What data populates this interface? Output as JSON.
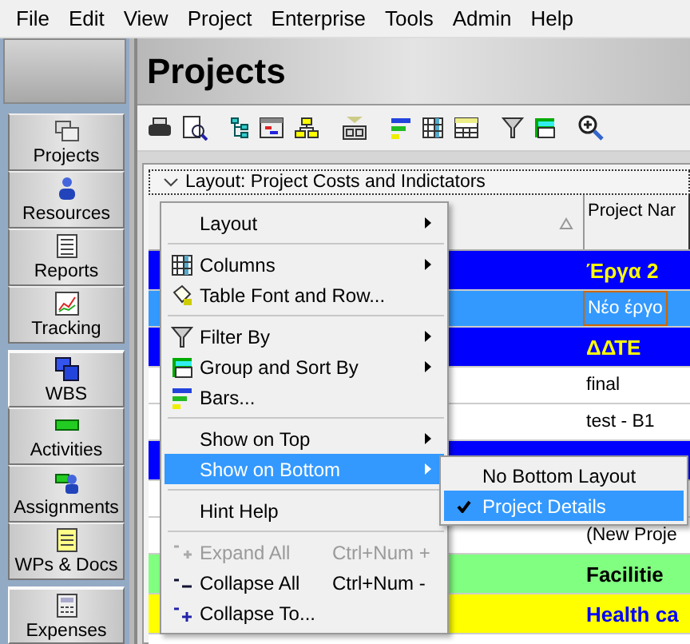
{
  "menu_bar": [
    "File",
    "Edit",
    "View",
    "Project",
    "Enterprise",
    "Tools",
    "Admin",
    "Help"
  ],
  "sidebar": {
    "items": [
      {
        "label": "Projects",
        "group_start": false
      },
      {
        "label": "Resources",
        "group_start": false
      },
      {
        "label": "Reports",
        "group_start": false
      },
      {
        "label": "Tracking",
        "group_start": false
      },
      {
        "label": "WBS",
        "group_start": true
      },
      {
        "label": "Activities",
        "group_start": false
      },
      {
        "label": "Assignments",
        "group_start": false
      },
      {
        "label": "WPs & Docs",
        "group_start": false
      },
      {
        "label": "Expenses",
        "group_start": true
      }
    ]
  },
  "page_title": "Projects",
  "layout_bar": {
    "label": "Layout: Project Costs and Indictators",
    "expanded": true
  },
  "table": {
    "columns": [
      "Project Nar"
    ],
    "rows": [
      {
        "kind": "group",
        "color": "#0000ff",
        "text": "Έργα 2"
      },
      {
        "kind": "project",
        "color": "#3399ff",
        "text": "Νέο έργο",
        "selected": true
      },
      {
        "kind": "group",
        "color": "#0000ff",
        "text": "ΔΔΤΕ"
      },
      {
        "kind": "project",
        "color": "#ffffff",
        "text": "final",
        "selected": false
      },
      {
        "kind": "project",
        "color": "#ffffff",
        "text": "test - B1",
        "selected": false
      },
      {
        "kind": "group",
        "color": "#0000ff"
      },
      {
        "kind": "project",
        "color": "#ffffff"
      },
      {
        "kind": "project",
        "color": "#ffffff",
        "text": "(New Proje",
        "selected": false
      },
      {
        "kind": "group",
        "color": "#80ff80",
        "text": "Facilitie"
      },
      {
        "kind": "group",
        "color": "#ffff00",
        "text": "Health ca"
      },
      {
        "kind": "project",
        "color": "#ffffff"
      }
    ]
  },
  "context_menu": {
    "items": [
      {
        "kind": "item",
        "label": "Layout",
        "submenu": true,
        "disabled": false,
        "selected": false
      },
      {
        "kind": "separator"
      },
      {
        "kind": "item",
        "label": "Columns",
        "submenu": true,
        "disabled": false,
        "selected": false
      },
      {
        "kind": "item",
        "label": "Table Font and Row...",
        "submenu": false,
        "disabled": false,
        "selected": false
      },
      {
        "kind": "separator"
      },
      {
        "kind": "item",
        "label": "Filter By",
        "submenu": true,
        "disabled": false,
        "selected": false
      },
      {
        "kind": "item",
        "label": "Group and Sort By",
        "submenu": true,
        "disabled": false,
        "selected": false
      },
      {
        "kind": "item",
        "label": "Bars...",
        "submenu": false,
        "disabled": false,
        "selected": false
      },
      {
        "kind": "separator"
      },
      {
        "kind": "item",
        "label": "Show on Top",
        "submenu": true,
        "disabled": false,
        "selected": false
      },
      {
        "kind": "item",
        "label": "Show on Bottom",
        "submenu": true,
        "disabled": false,
        "selected": true
      },
      {
        "kind": "separator"
      },
      {
        "kind": "item",
        "label": "Hint Help",
        "submenu": false,
        "disabled": false,
        "selected": false
      },
      {
        "kind": "separator"
      },
      {
        "kind": "item",
        "label": "Expand All",
        "shortcut": "Ctrl+Num +",
        "submenu": false,
        "disabled": true,
        "selected": false
      },
      {
        "kind": "item",
        "label": "Collapse All",
        "shortcut": "Ctrl+Num -",
        "submenu": false,
        "disabled": false,
        "selected": false
      },
      {
        "kind": "item",
        "label": "Collapse To...",
        "submenu": false,
        "disabled": false,
        "selected": false
      }
    ]
  },
  "submenu": {
    "items": [
      {
        "label": "No Bottom Layout",
        "checked": false,
        "selected": false
      },
      {
        "label": "Project Details",
        "checked": true,
        "selected": true
      }
    ]
  }
}
